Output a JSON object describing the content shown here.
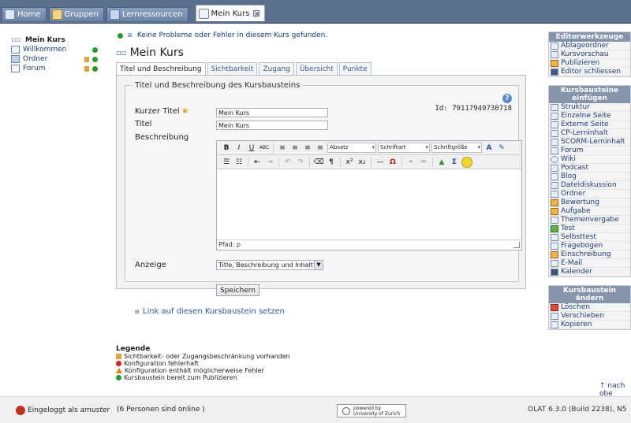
{
  "topnav": {
    "tabs": [
      {
        "label": "Home"
      },
      {
        "label": "Gruppen"
      },
      {
        "label": "Lernressourcen"
      },
      {
        "label": "Mein Kurs"
      }
    ]
  },
  "tree": {
    "root": "Mein Kurs",
    "items": [
      {
        "label": "Willkommen"
      },
      {
        "label": "Ordner"
      },
      {
        "label": "Forum"
      }
    ]
  },
  "main": {
    "message": "Keine Probleme oder Fehler in diesem Kurs gefunden.",
    "title": "Mein Kurs",
    "tabs": [
      "Titel und Beschreibung",
      "Sichtbarkeit",
      "Zugang",
      "Übersicht",
      "Punkte"
    ],
    "fieldset_title": "Titel und Beschreibung des Kursbausteins",
    "id_text": "Id: 79117949730718",
    "short_title_label": "Kurzer Titel",
    "short_title_value": "Mein Kurs",
    "title_label": "Titel",
    "title_value": "Mein Kurs",
    "description_label": "Beschreibung",
    "editor": {
      "format_select": "Absatz",
      "font_select": "Schriftart",
      "size_select": "Schriftgröße",
      "path": "Pfad: p"
    },
    "display_label": "Anzeige",
    "display_value": "Title, Beschreibung und Inhalt",
    "save_button": "Speichern",
    "link_text": "Link auf diesen Kursbaustein setzen"
  },
  "legend": {
    "title": "Legende",
    "items": [
      "Sichtbarkeit- oder Zugangsbeschränkung vorhanden",
      "Konfiguration fehlerhaft",
      "Konfiguration enthält möglicherweise Fehler",
      "Kursbaustein bereit zum Publizieren"
    ]
  },
  "right": {
    "tools": {
      "title": "Editorwerkzeuge",
      "items": [
        "Ablageordner",
        "Kursvorschau",
        "Publizieren",
        "Editor schliessen"
      ]
    },
    "insert": {
      "title": "Kursbausteine einfügen",
      "items": [
        "Struktur",
        "Einzelne Seite",
        "Externe Seite",
        "CP-Lerninhalt",
        "SCORM-Lerninhalt",
        "Forum",
        "Wiki",
        "Podcast",
        "Blog",
        "Dateidiskussion",
        "Ordner",
        "Bewertung",
        "Aufgabe",
        "Themenvergabe",
        "Test",
        "Selbsttest",
        "Fragebogen",
        "Einschreibung",
        "E-Mail",
        "Kalender"
      ]
    },
    "change": {
      "title": "Kursbaustein ändern",
      "items": [
        "Löschen",
        "Verschieben",
        "Kopieren"
      ]
    },
    "back_link": "nach obe"
  },
  "footer": {
    "logged_in_prefix": "Eingeloggt als",
    "user": "amuster",
    "online": "(6 Personen sind online )",
    "powered_line1": "powered by",
    "powered_line2": "University of Zurich",
    "version": "OLAT 6.3.0 (Build 2238), N5"
  }
}
